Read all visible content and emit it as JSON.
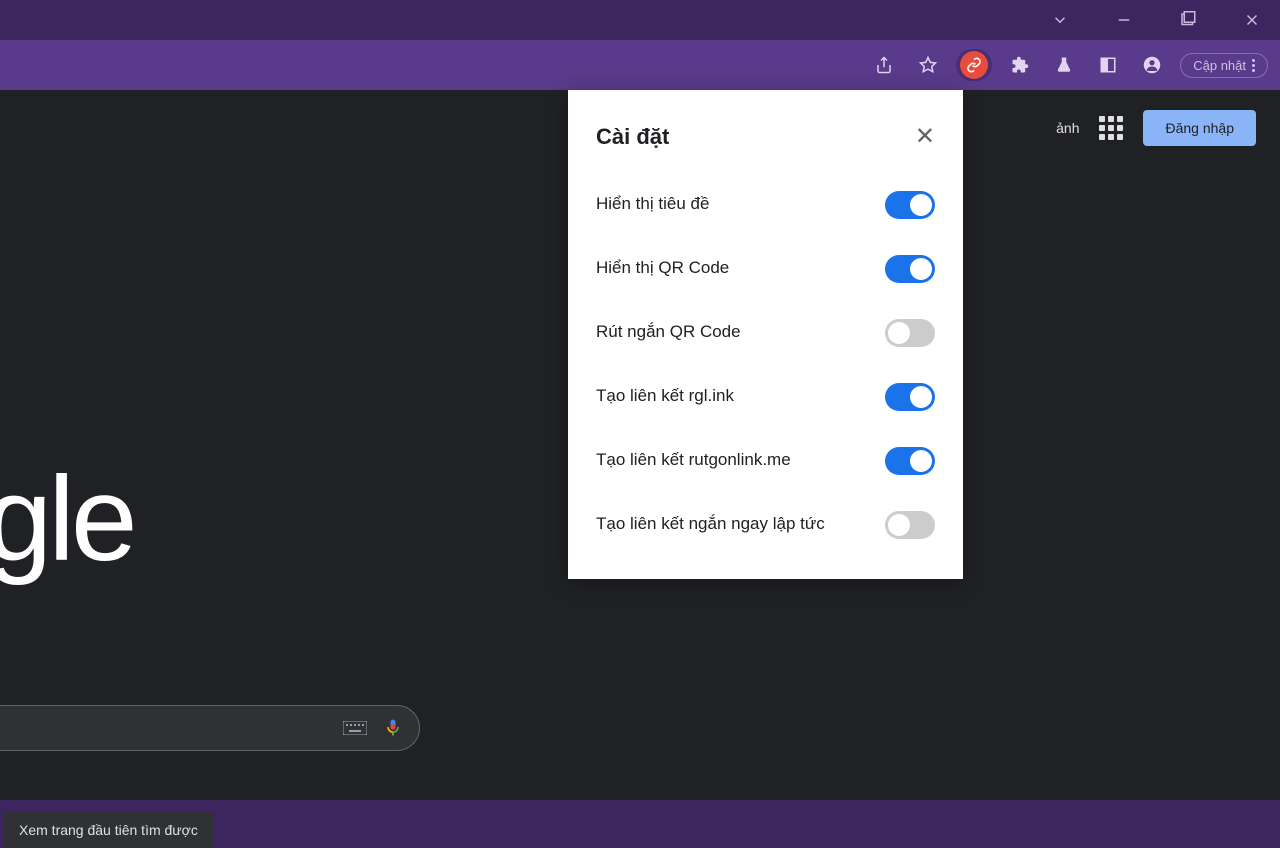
{
  "titlebar": {
    "minimize": "minimize",
    "maximize": "maximize",
    "close": "close",
    "dropdown": "dropdown"
  },
  "toolbar": {
    "update_label": "Cập nhật"
  },
  "content": {
    "images_text": "ảnh",
    "signin_label": "Đăng nhập",
    "logo_text": "oogle",
    "first_result_label": "Xem trang đầu tiên tìm được"
  },
  "popup": {
    "title": "Cài đặt",
    "items": [
      {
        "label": "Hiển thị tiêu đề",
        "on": true
      },
      {
        "label": "Hiển thị QR Code",
        "on": true
      },
      {
        "label": "Rút ngắn QR Code",
        "on": false
      },
      {
        "label": "Tạo liên kết rgl.ink",
        "on": true
      },
      {
        "label": "Tạo liên kết rutgonlink.me",
        "on": true
      },
      {
        "label": "Tạo liên kết ngắn ngay lập tức",
        "on": false
      }
    ]
  }
}
